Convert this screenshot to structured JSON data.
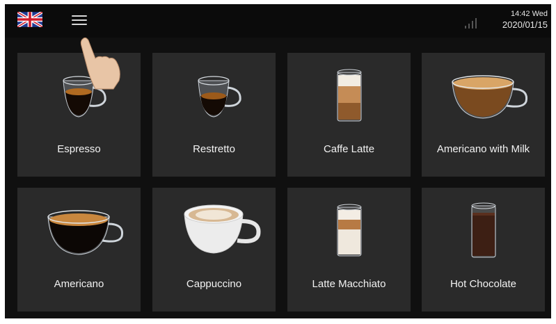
{
  "status": {
    "time": "14:42 Wed",
    "date": "2020/01/15"
  },
  "icons": {
    "language": "uk-flag-icon",
    "menu": "hamburger-menu-icon",
    "signal": "signal-strength-icon",
    "hint": "pointing-hand-icon"
  },
  "drinks": [
    {
      "label": "Espresso",
      "icon": "espresso-cup-icon"
    },
    {
      "label": "Restretto",
      "icon": "ristretto-cup-icon"
    },
    {
      "label": "Caffe Latte",
      "icon": "caffe-latte-glass-icon"
    },
    {
      "label": "Americano with Milk",
      "icon": "americano-with-milk-cup-icon"
    },
    {
      "label": "Americano",
      "icon": "americano-cup-icon"
    },
    {
      "label": "Cappuccino",
      "icon": "cappuccino-cup-icon"
    },
    {
      "label": "Latte Macchiato",
      "icon": "latte-macchiato-glass-icon"
    },
    {
      "label": "Hot Chocolate",
      "icon": "hot-chocolate-glass-icon"
    }
  ],
  "colors": {
    "background": "#101010",
    "tile": "#2a2a2a",
    "text": "#f2f2f2"
  }
}
